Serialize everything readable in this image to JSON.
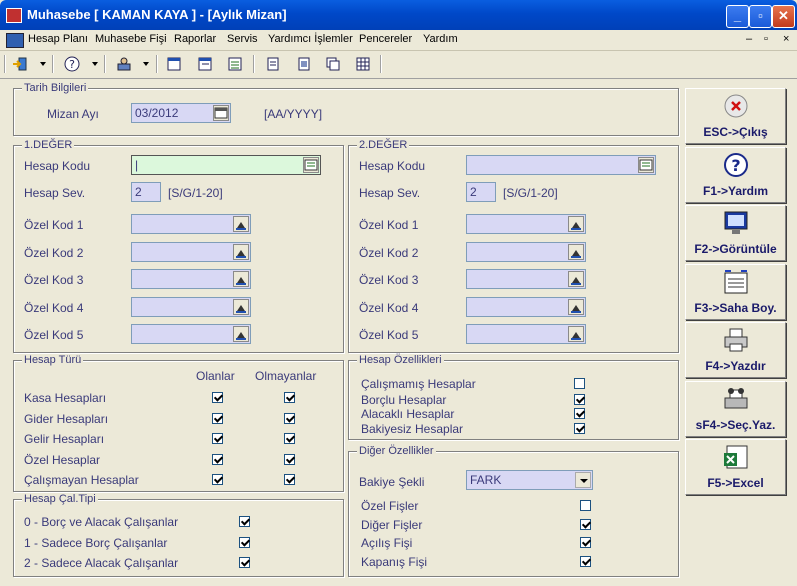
{
  "window": {
    "title": "Muhasebe [ KAMAN KAYA ]  - [Aylık Mizan]"
  },
  "menu": [
    "Hesap Planı",
    "Muhasebe Fişi",
    "Raporlar",
    "Servis",
    "Yardımcı İşlemler",
    "Pencereler",
    "Yardım"
  ],
  "mdi_controls": [
    "–",
    "▫",
    "×"
  ],
  "tarih": {
    "title": "Tarih Bilgileri",
    "mizan_ayi_label": "Mizan Ayı",
    "mizan_ayi_value": "03/2012",
    "format_hint": "[AA/YYYY]"
  },
  "deger1": {
    "title": "1.DEĞER",
    "hesap_kodu_label": "Hesap Kodu",
    "hesap_kodu_value": "",
    "hesap_sev_label": "Hesap Sev.",
    "hesap_sev_value": "2",
    "hesap_sev_hint": "[S/G/1-20]",
    "ozel_kod_labels": [
      "Özel Kod 1",
      "Özel Kod 2",
      "Özel Kod 3",
      "Özel Kod 4",
      "Özel Kod 5"
    ]
  },
  "deger2": {
    "title": "2.DEĞER",
    "hesap_kodu_label": "Hesap Kodu",
    "hesap_kodu_value": "",
    "hesap_sev_label": "Hesap Sev.",
    "hesap_sev_value": "2",
    "hesap_sev_hint": "[S/G/1-20]",
    "ozel_kod_labels": [
      "Özel Kod 1",
      "Özel Kod 2",
      "Özel Kod 3",
      "Özel Kod 4",
      "Özel Kod 5"
    ]
  },
  "hesap_turu": {
    "title": "Hesap Türü",
    "col_olanlar": "Olanlar",
    "col_olmayanlar": "Olmayanlar",
    "rows": [
      {
        "label": "Kasa Hesapları",
        "olanlar": true,
        "olmayanlar": true
      },
      {
        "label": "Gider Hesapları",
        "olanlar": true,
        "olmayanlar": true
      },
      {
        "label": "Gelir Hesapları",
        "olanlar": true,
        "olmayanlar": true
      },
      {
        "label": "Özel Hesaplar",
        "olanlar": true,
        "olmayanlar": true
      },
      {
        "label": "Çalışmayan Hesaplar",
        "olanlar": true,
        "olmayanlar": true
      }
    ]
  },
  "hesap_cal_tipi": {
    "title": "Hesap Çal.Tipi",
    "rows": [
      {
        "label": "0 - Borç ve Alacak Çalışanlar",
        "checked": true
      },
      {
        "label": "1 - Sadece Borç Çalışanlar",
        "checked": true
      },
      {
        "label": "2 - Sadece Alacak Çalışanlar",
        "checked": true
      }
    ]
  },
  "hesap_ozellikleri": {
    "title": "Hesap Özellikleri",
    "rows": [
      {
        "label": "Çalışmamış Hesaplar",
        "checked": false
      },
      {
        "label": "Borçlu Hesaplar",
        "checked": true
      },
      {
        "label": "Alacaklı Hesaplar",
        "checked": true
      },
      {
        "label": "Bakiyesiz Hesaplar",
        "checked": true
      }
    ]
  },
  "diger_ozellikler": {
    "title": "Diğer Özellikler",
    "bakiye_sekli_label": "Bakiye Şekli",
    "bakiye_sekli_value": "FARK",
    "rows": [
      {
        "label": "Özel Fişler",
        "checked": false
      },
      {
        "label": "Diğer Fişler",
        "checked": true
      },
      {
        "label": "Açılış Fişi",
        "checked": true
      },
      {
        "label": "Kapanış Fişi",
        "checked": true
      }
    ]
  },
  "side_buttons": [
    {
      "label": "ESC->Çıkış",
      "icon": "exit-icon"
    },
    {
      "label": "F1->Yardım",
      "icon": "help-icon"
    },
    {
      "label": "F2->Görüntüle",
      "icon": "monitor-icon"
    },
    {
      "label": "F3->Saha Boy.",
      "icon": "field-size-icon"
    },
    {
      "label": "F4->Yazdır",
      "icon": "printer-icon"
    },
    {
      "label": "sF4->Seç.Yaz.",
      "icon": "select-print-icon"
    },
    {
      "label": "F5->Excel",
      "icon": "excel-icon"
    }
  ],
  "colors": {
    "title_bar": "#0048c8",
    "input_bg": "#d8d8f4",
    "focus_input_bg": "#dcf8dc",
    "label_text": "#3a3a7a"
  }
}
